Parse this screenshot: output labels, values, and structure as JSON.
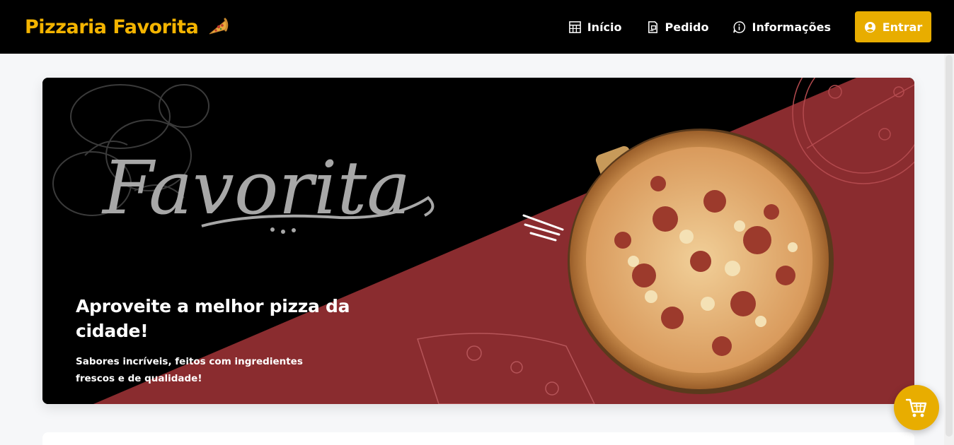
{
  "brand": {
    "name": "Pizzaria Favorita",
    "icon": "pizza-slice-icon"
  },
  "nav": {
    "items": [
      {
        "label": "Início",
        "icon": "store-icon"
      },
      {
        "label": "Pedido",
        "icon": "receipt-icon"
      },
      {
        "label": "Informações",
        "icon": "info-icon"
      }
    ],
    "login": {
      "label": "Entrar",
      "icon": "user-circle-icon"
    }
  },
  "hero": {
    "script_logo": "Favorita",
    "title": "Aproveite a melhor pizza da cidade!",
    "subtitle": "Sabores incríveis, feitos com ingredientes frescos e de qualidade!"
  },
  "cart": {
    "icon": "shopping-cart-icon"
  },
  "colors": {
    "brand_yellow": "#f4b400",
    "button_yellow": "#e8ad00",
    "hero_red": "#8a2c2f",
    "topbar": "#000000",
    "page_bg": "#f6f7f9"
  }
}
